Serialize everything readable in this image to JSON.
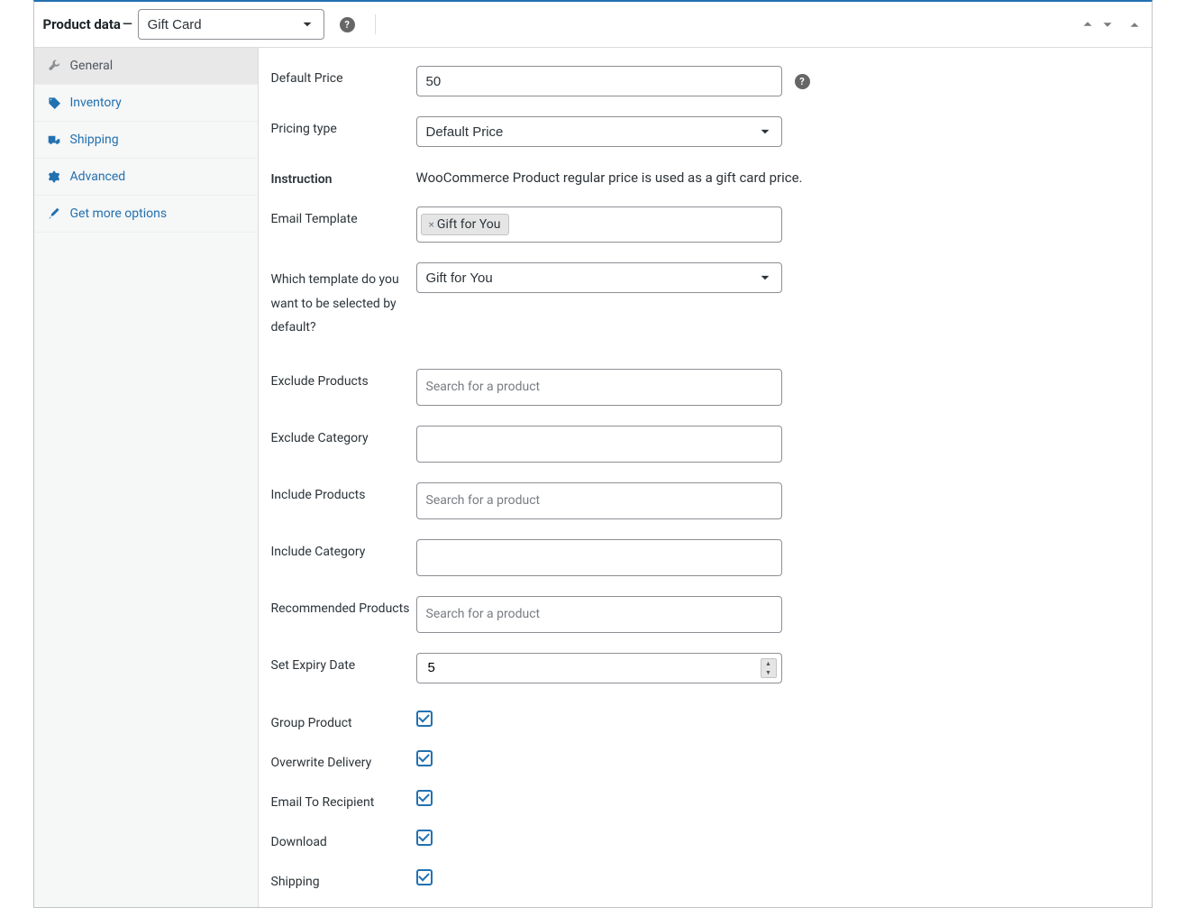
{
  "header": {
    "title": "Product data",
    "dash": "—",
    "product_type": "Gift Card"
  },
  "sidebar": {
    "items": [
      {
        "label": "General"
      },
      {
        "label": "Inventory"
      },
      {
        "label": "Shipping"
      },
      {
        "label": "Advanced"
      },
      {
        "label": "Get more options"
      }
    ]
  },
  "form": {
    "default_price": {
      "label": "Default Price",
      "value": "50"
    },
    "pricing_type": {
      "label": "Pricing type",
      "value": "Default Price"
    },
    "instruction": {
      "label": "Instruction",
      "text": "WooCommerce Product regular price is used as a gift card price."
    },
    "email_template": {
      "label": "Email Template",
      "tag": "Gift for You"
    },
    "default_template": {
      "label": "Which template do you want to be selected by default?",
      "value": "Gift for You"
    },
    "exclude_products": {
      "label": "Exclude Products",
      "placeholder": "Search for a product"
    },
    "exclude_category": {
      "label": "Exclude Category"
    },
    "include_products": {
      "label": "Include Products",
      "placeholder": "Search for a product"
    },
    "include_category": {
      "label": "Include Category"
    },
    "recommended_products": {
      "label": "Recommended Products",
      "placeholder": "Search for a product"
    },
    "expiry_date": {
      "label": "Set Expiry Date",
      "value": "5"
    },
    "group_product": {
      "label": "Group Product",
      "checked": true
    },
    "overwrite_delivery": {
      "label": "Overwrite Delivery",
      "checked": true
    },
    "email_to_recipient": {
      "label": "Email To Recipient",
      "checked": true
    },
    "download": {
      "label": "Download",
      "checked": true
    },
    "shipping": {
      "label": "Shipping",
      "checked": true
    }
  }
}
